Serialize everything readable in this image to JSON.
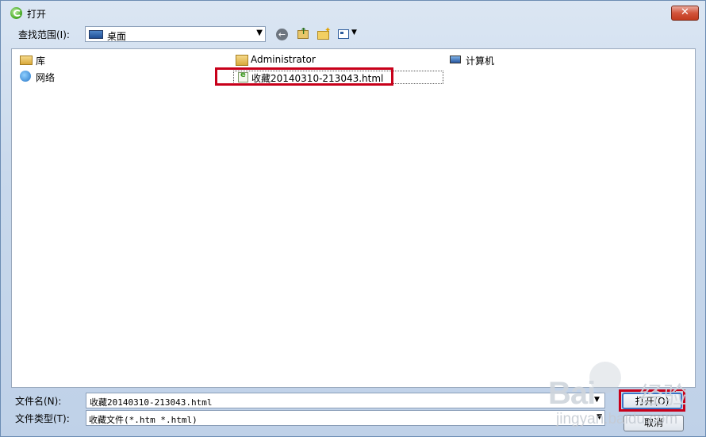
{
  "window": {
    "title": "打开",
    "close_label": "✕"
  },
  "toolbar": {
    "lookin_label": "查找范围(I):",
    "lookin_value": "桌面",
    "icons": [
      "back-icon",
      "up-folder-icon",
      "new-folder-icon",
      "views-menu-icon"
    ]
  },
  "files": [
    {
      "name": "库",
      "icon": "library-icon"
    },
    {
      "name": "网络",
      "icon": "network-icon"
    },
    {
      "name": "Administrator",
      "icon": "user-folder-icon"
    },
    {
      "name": "收藏20140310-213043.html",
      "icon": "html-file-icon"
    },
    {
      "name": "计算机",
      "icon": "computer-icon"
    }
  ],
  "form": {
    "filename_label": "文件名(N):",
    "filename_value": "收藏20140310-213043.html",
    "filetype_label": "文件类型(T):",
    "filetype_value": "收藏文件(*.htm *.html)"
  },
  "buttons": {
    "open": "打开(O)",
    "cancel": "取消"
  },
  "watermark": {
    "brand": "Bai",
    "cn": "经验",
    "url": "jingyan.baidu.com"
  },
  "colors": {
    "highlight": "#c8001a",
    "window_bg": "#c9d9ec"
  }
}
